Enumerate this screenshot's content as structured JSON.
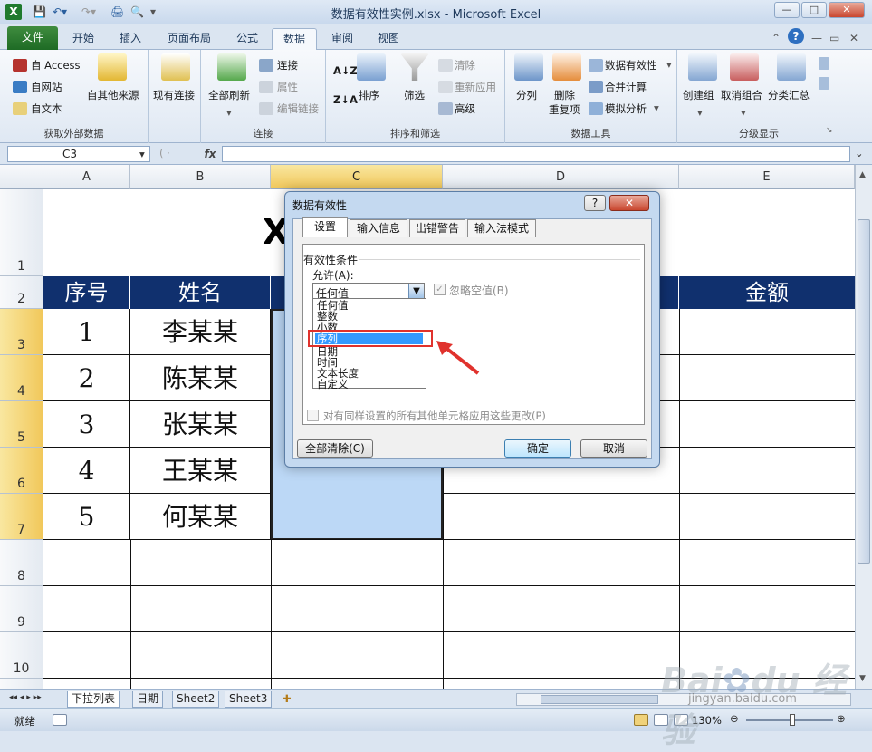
{
  "window": {
    "title": "数据有效性实例.xlsx - Microsoft Excel",
    "controls": [
      "—",
      "□",
      "✕"
    ]
  },
  "ribbon_tabs": [
    {
      "label": "文件"
    },
    {
      "label": "开始"
    },
    {
      "label": "插入"
    },
    {
      "label": "页面布局"
    },
    {
      "label": "公式"
    },
    {
      "label": "数据"
    },
    {
      "label": "审阅"
    },
    {
      "label": "视图"
    }
  ],
  "ribbon": {
    "get_external": {
      "label": "获取外部数据",
      "access": "自 Access",
      "web": "自网站",
      "text": "自文本",
      "other": "自其他来源",
      "existing": "现有连接"
    },
    "connections": {
      "label": "连接",
      "refresh_all": "全部刷新",
      "connections": "连接",
      "properties": "属性",
      "edit_links": "编辑链接"
    },
    "sort_filter": {
      "label": "排序和筛选",
      "sort": "排序",
      "filter": "筛选",
      "clear": "清除",
      "reapply": "重新应用",
      "advanced": "高级"
    },
    "data_tools": {
      "label": "数据工具",
      "split": "分列",
      "remove_dup_1": "删除",
      "remove_dup_2": "重复项",
      "validation": "数据有效性",
      "consolidate": "合并计算",
      "what_if": "模拟分析"
    },
    "outline": {
      "label": "分级显示",
      "group": "创建组",
      "ungroup": "取消组合",
      "subtotal": "分类汇总"
    }
  },
  "formula_bar": {
    "name_box": "C3",
    "fx": "fx",
    "value": ""
  },
  "sheet": {
    "columns": [
      "A",
      "B",
      "C",
      "D",
      "E"
    ],
    "rows": [
      "1",
      "2",
      "3",
      "4",
      "5",
      "6",
      "7",
      "8",
      "9",
      "10"
    ],
    "title_fragment": "X",
    "headers": [
      "序号",
      "姓名",
      "",
      "",
      "金额"
    ],
    "data_rows": [
      [
        "1",
        "李某某"
      ],
      [
        "2",
        "陈某某"
      ],
      [
        "3",
        "张某某"
      ],
      [
        "4",
        "王某某"
      ],
      [
        "5",
        "何某某"
      ]
    ]
  },
  "sheet_tabs": [
    {
      "label": "下拉列表",
      "active": true
    },
    {
      "label": "日期",
      "active": false
    },
    {
      "label": "Sheet2",
      "active": false
    },
    {
      "label": "Sheet3",
      "active": false
    }
  ],
  "status": {
    "mode": "就绪",
    "zoom": "130%"
  },
  "dialog": {
    "title": "数据有效性",
    "tabs": [
      "设置",
      "输入信息",
      "出错警告",
      "输入法模式"
    ],
    "section_title": "有效性条件",
    "allow_label": "允许(A):",
    "allow_value": "任何值",
    "ignore_blank": "忽略空值(B)",
    "options": [
      "任何值",
      "整数",
      "小数",
      "序列",
      "日期",
      "时间",
      "文本长度",
      "自定义"
    ],
    "highlighted_option": "序列",
    "apply_all": "对有同样设置的所有其他单元格应用这些更改(P)",
    "clear_all": "全部清除(C)",
    "ok": "确定",
    "cancel": "取消"
  },
  "colors": {
    "header_fill": "#10306e",
    "selection_fill": "#bcd8f6",
    "highlight_box": "#e0322d",
    "arrow": "#e0322d"
  }
}
